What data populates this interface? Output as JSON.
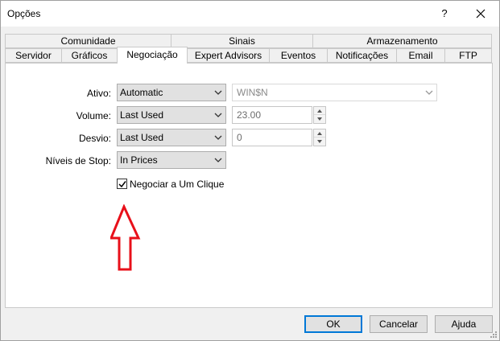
{
  "window": {
    "title": "Opções",
    "help_glyph": "?",
    "accent_color": "#0078d7"
  },
  "tabs": {
    "top_row": [
      {
        "label": "Comunidade"
      },
      {
        "label": "Sinais"
      },
      {
        "label": "Armazenamento"
      }
    ],
    "bottom_row": [
      {
        "label": "Servidor"
      },
      {
        "label": "Gráficos"
      },
      {
        "label": "Negociação",
        "active": true
      },
      {
        "label": "Expert Advisors"
      },
      {
        "label": "Eventos"
      },
      {
        "label": "Notificações"
      },
      {
        "label": "Email"
      },
      {
        "label": "FTP"
      }
    ]
  },
  "form": {
    "ativo": {
      "label": "Ativo:",
      "value": "Automatic",
      "symbol": "WIN$N"
    },
    "volume": {
      "label": "Volume:",
      "value": "Last Used",
      "amount": "23.00"
    },
    "desvio": {
      "label": "Desvio:",
      "value": "Last Used",
      "amount": "0"
    },
    "niveis": {
      "label": "Níveis de Stop:",
      "value": "In Prices"
    },
    "one_click": {
      "label": "Negociar a Um Clique",
      "checked": true
    }
  },
  "annotation": {
    "color": "#e8101a",
    "icon": "red-arrow-up-icon"
  },
  "buttons": {
    "ok": "OK",
    "cancel": "Cancelar",
    "help": "Ajuda"
  }
}
